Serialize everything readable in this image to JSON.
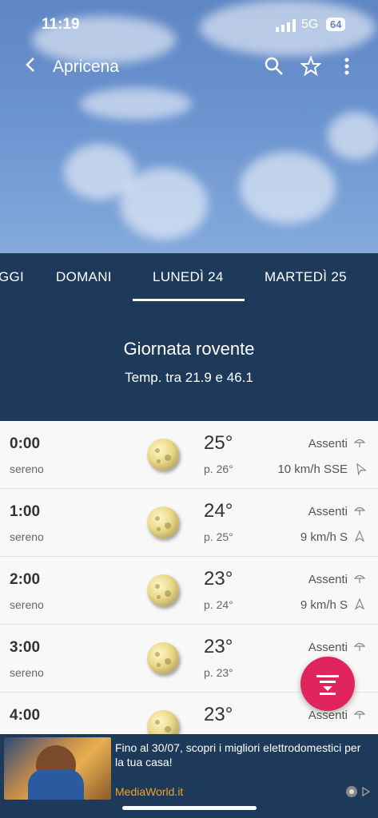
{
  "status_bar": {
    "time": "11:19",
    "network": "5G",
    "battery": "64"
  },
  "app_bar": {
    "title": "Apricena"
  },
  "tabs": [
    {
      "label": "GGI"
    },
    {
      "label": "DOMANI"
    },
    {
      "label": "LUNEDÌ 24",
      "selected": true
    },
    {
      "label": "MARTEDÌ 25"
    }
  ],
  "day_summary": {
    "title": "Giornata rovente",
    "subtitle": "Temp. tra 21.9 e 46.1"
  },
  "hours": [
    {
      "hour": "0:00",
      "condition": "sereno",
      "temp": "25°",
      "perceived": "p. 26°",
      "rain": "Assenti",
      "wind": "10 km/h SSE"
    },
    {
      "hour": "1:00",
      "condition": "sereno",
      "temp": "24°",
      "perceived": "p. 25°",
      "rain": "Assenti",
      "wind": "9 km/h S"
    },
    {
      "hour": "2:00",
      "condition": "sereno",
      "temp": "23°",
      "perceived": "p. 24°",
      "rain": "Assenti",
      "wind": "9 km/h S"
    },
    {
      "hour": "3:00",
      "condition": "sereno",
      "temp": "23°",
      "perceived": "p. 23°",
      "rain": "Assenti",
      "wind": "9"
    },
    {
      "hour": "4:00",
      "condition": "",
      "temp": "23°",
      "perceived": "",
      "rain": "Assenti",
      "wind": ""
    }
  ],
  "ad": {
    "text": "Fino al 30/07, scopri i migliori elettrodomestici per la tua casa!",
    "brand": "MediaWorld.it"
  },
  "colors": {
    "header_bg": "#1d3a5b",
    "fab": "#e0245e",
    "ad_brand": "#f4a11c"
  },
  "icons": [
    "back-icon",
    "search-icon",
    "star-icon",
    "more-vert-icon",
    "moon-icon",
    "umbrella-icon",
    "wind-arrow-icon",
    "filter-icon"
  ]
}
